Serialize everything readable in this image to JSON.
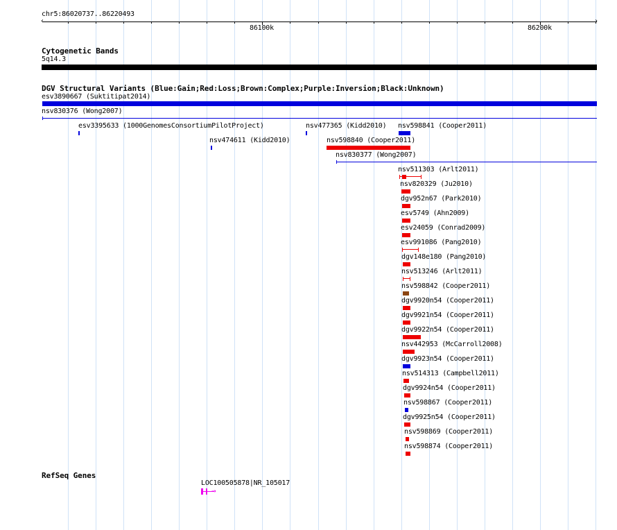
{
  "ruler": {
    "location": "chr5:86020737..86220493",
    "ticks": [
      {
        "label": "86100k",
        "pos": 86100000
      },
      {
        "label": "86200k",
        "pos": 86200000
      }
    ]
  },
  "cytobands": {
    "title": "Cytogenetic Bands",
    "band": "5q14.3"
  },
  "dgv": {
    "title": "DGV Structural Variants (Blue:Gain;Red:Loss;Brown:Complex;Purple:Inversion;Black:Unknown)",
    "colors": {
      "gain": "#0000dd",
      "loss": "#ee0000",
      "complex": "#8b4513",
      "inversion": "#800080",
      "unknown": "#000000"
    },
    "features": [
      {
        "id": "sv-esv3890667",
        "label": "esv3890667 (Suktitipat2014)",
        "type": "gain",
        "start": 86020737,
        "end": 86220493,
        "style": "thick"
      },
      {
        "id": "sv-nsv830376",
        "label": "nsv830376 (Wong2007)",
        "type": "gain",
        "start": 86020737,
        "end": 86220493,
        "style": "line"
      },
      {
        "id": "sv-esv3395633",
        "label": "esv3395633 (1000GenomesConsortiumPilotProject)",
        "type": "gain",
        "start": 86033800,
        "end": 86033900,
        "style": "tick"
      },
      {
        "id": "sv-nsv477365",
        "label": "nsv477365 (Kidd2010)",
        "type": "gain",
        "start": 86115600,
        "end": 86115700,
        "style": "tick"
      },
      {
        "id": "sv-nsv598841",
        "label": "nsv598841 (Cooper2011)",
        "type": "gain",
        "start": 86149000,
        "end": 86153300,
        "style": "box"
      },
      {
        "id": "sv-nsv474611",
        "label": "nsv474611 (Kidd2010)",
        "type": "gain",
        "start": 86081400,
        "end": 86081500,
        "style": "tick"
      },
      {
        "id": "sv-nsv598840",
        "label": "nsv598840 (Cooper2011)",
        "type": "loss",
        "start": 86123000,
        "end": 86153300,
        "style": "box"
      },
      {
        "id": "sv-nsv830377",
        "label": "nsv830377 (Wong2007)",
        "type": "gain",
        "start": 86126600,
        "end": 86220493,
        "style": "line"
      },
      {
        "id": "sv-nsv511303",
        "label": "nsv511303 (Arlt2011)",
        "type": "loss",
        "start": 86149400,
        "end": 86157400,
        "style": "split"
      },
      {
        "id": "sv-nsv820329",
        "label": "nsv820329 (Ju2010)",
        "type": "loss",
        "start": 86150200,
        "end": 86153300,
        "style": "box"
      },
      {
        "id": "sv-dgv952n67",
        "label": "dgv952n67 (Park2010)",
        "type": "loss",
        "start": 86150300,
        "end": 86153300,
        "style": "box"
      },
      {
        "id": "sv-esv5749",
        "label": "esv5749 (Ahn2009)",
        "type": "loss",
        "start": 86150300,
        "end": 86153300,
        "style": "box"
      },
      {
        "id": "sv-esv24059",
        "label": "esv24059 (Conrad2009)",
        "type": "loss",
        "start": 86150300,
        "end": 86153300,
        "style": "box"
      },
      {
        "id": "sv-esv991086",
        "label": "esv991086 (Pang2010)",
        "type": "loss",
        "start": 86150300,
        "end": 86156400,
        "style": "whisker"
      },
      {
        "id": "sv-dgv148e180",
        "label": "dgv148e180 (Pang2010)",
        "type": "loss",
        "start": 86150500,
        "end": 86153300,
        "style": "box"
      },
      {
        "id": "sv-nsv513246",
        "label": "nsv513246 (Arlt2011)",
        "type": "loss",
        "start": 86150500,
        "end": 86153300,
        "style": "whisker"
      },
      {
        "id": "sv-nsv598842",
        "label": "nsv598842 (Cooper2011)",
        "type": "complex",
        "start": 86150700,
        "end": 86152800,
        "style": "box"
      },
      {
        "id": "sv-dgv9920n54",
        "label": "dgv9920n54 (Cooper2011)",
        "type": "loss",
        "start": 86150700,
        "end": 86153300,
        "style": "box"
      },
      {
        "id": "sv-dgv9921n54",
        "label": "dgv9921n54 (Cooper2011)",
        "type": "loss",
        "start": 86150700,
        "end": 86153300,
        "style": "box"
      },
      {
        "id": "sv-dgv9922n54",
        "label": "dgv9922n54 (Cooper2011)",
        "type": "loss",
        "start": 86150700,
        "end": 86157100,
        "style": "box"
      },
      {
        "id": "sv-nsv442953",
        "label": "nsv442953 (McCarroll2008)",
        "type": "loss",
        "start": 86150700,
        "end": 86154700,
        "style": "box"
      },
      {
        "id": "sv-dgv9923n54",
        "label": "dgv9923n54 (Cooper2011)",
        "type": "gain",
        "start": 86150700,
        "end": 86153300,
        "style": "box"
      },
      {
        "id": "sv-nsv514313",
        "label": "nsv514313 (Campbell2011)",
        "type": "loss",
        "start": 86150900,
        "end": 86152800,
        "style": "box"
      },
      {
        "id": "sv-dgv9924n54",
        "label": "dgv9924n54 (Cooper2011)",
        "type": "loss",
        "start": 86151100,
        "end": 86153300,
        "style": "box"
      },
      {
        "id": "sv-nsv598867",
        "label": "nsv598867 (Cooper2011)",
        "type": "gain",
        "start": 86151400,
        "end": 86152600,
        "style": "box"
      },
      {
        "id": "sv-dgv9925n54",
        "label": "dgv9925n54 (Cooper2011)",
        "type": "loss",
        "start": 86151100,
        "end": 86153300,
        "style": "box"
      },
      {
        "id": "sv-nsv598869",
        "label": "nsv598869 (Cooper2011)",
        "type": "loss",
        "start": 86151600,
        "end": 86152800,
        "style": "box"
      },
      {
        "id": "sv-nsv598874",
        "label": "nsv598874 (Cooper2011)",
        "type": "loss",
        "start": 86151600,
        "end": 86153300,
        "style": "box"
      }
    ]
  },
  "refseq": {
    "title": "RefSeq Genes",
    "gene": {
      "label": "LOC100505878|NR_105017",
      "start": 86078000,
      "end": 86082600,
      "strand": "+",
      "color": "#ee00ee"
    }
  }
}
